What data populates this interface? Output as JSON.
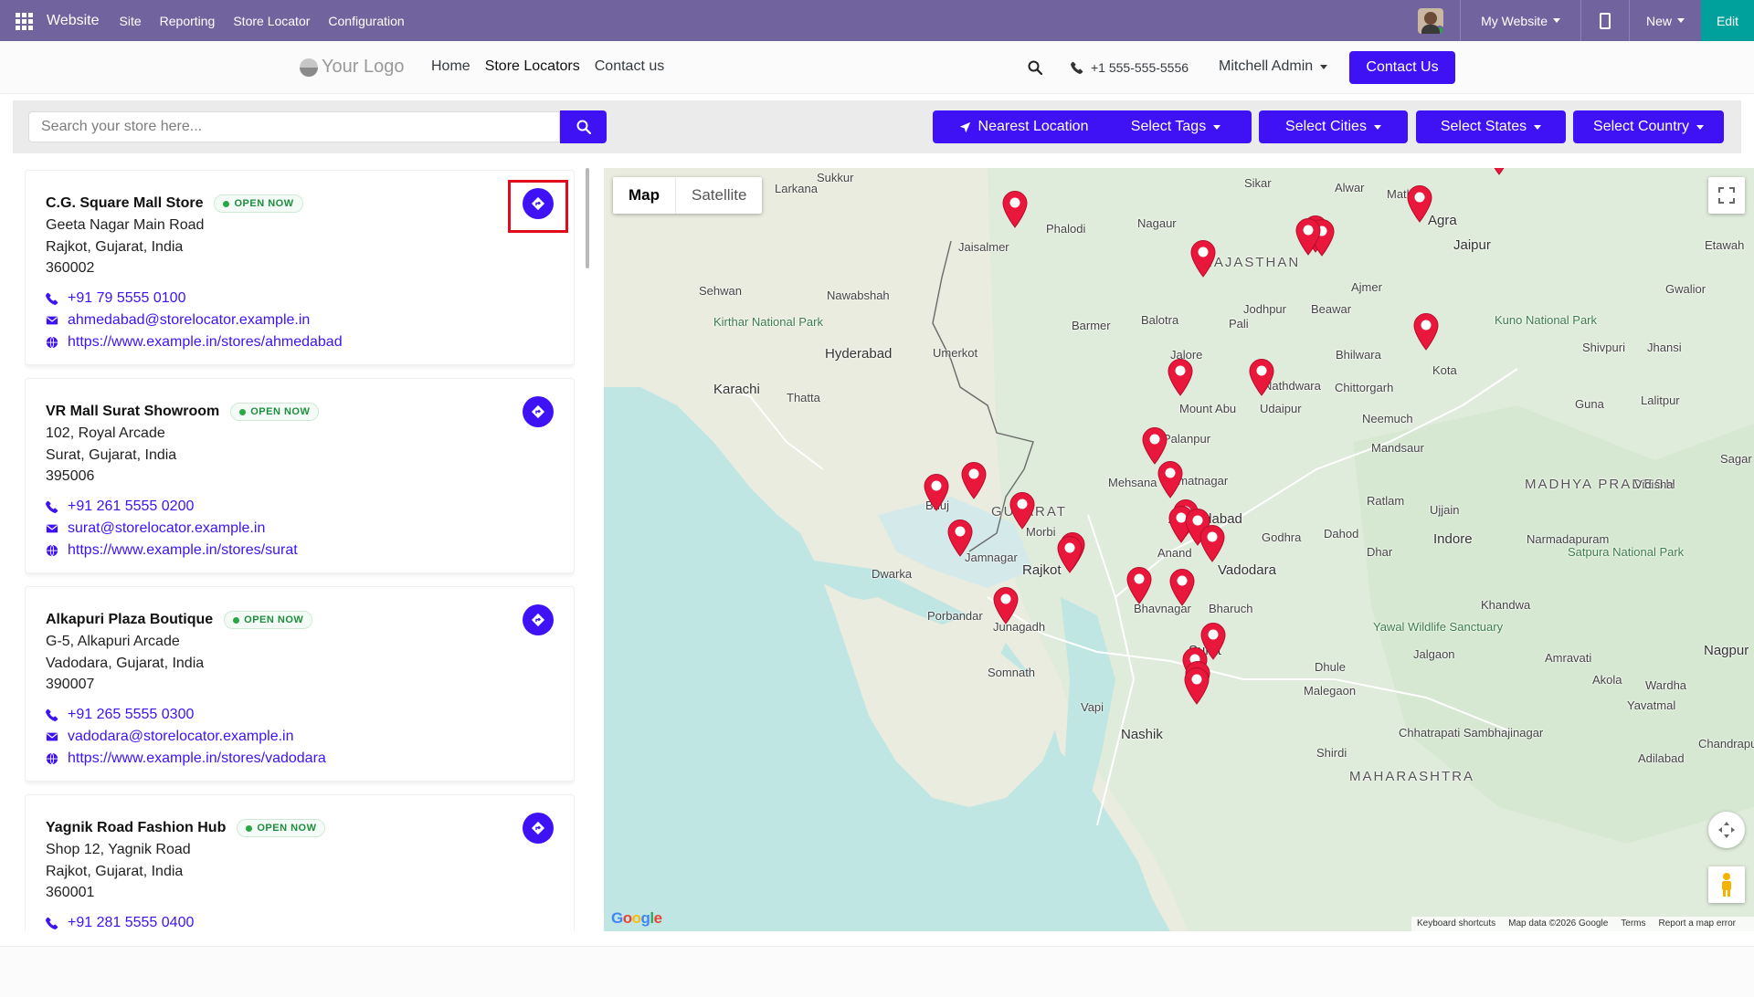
{
  "admin_bar": {
    "brand": "Website",
    "menu": [
      "Site",
      "Reporting",
      "Store Locator",
      "Configuration"
    ],
    "my_website": "My Website",
    "new_label": "New",
    "edit_label": "Edit"
  },
  "header": {
    "logo_text": "Your Logo",
    "nav": [
      "Home",
      "Store Locators",
      "Contact us"
    ],
    "phone": "+1 555-555-5556",
    "user": "Mitchell Admin",
    "contact_button": "Contact Us"
  },
  "filters": {
    "search_placeholder": "Search your store here...",
    "nearest": "Nearest Location",
    "tags": "Select Tags",
    "cities": "Select Cities",
    "states": "Select States",
    "country": "Select Country"
  },
  "stores": [
    {
      "name": "C.G. Square Mall Store",
      "status": "OPEN NOW",
      "address": [
        "Geeta Nagar Main Road",
        "Rajkot, Gujarat, India",
        "360002"
      ],
      "phone": "+91 79 5555 0100",
      "email": "ahmedabad@storelocator.example.in",
      "url": "https://www.example.in/stores/ahmedabad"
    },
    {
      "name": "VR Mall Surat Showroom",
      "status": "OPEN NOW",
      "address": [
        "102, Royal Arcade",
        "Surat, Gujarat, India",
        "395006"
      ],
      "phone": "+91 261 5555 0200",
      "email": "surat@storelocator.example.in",
      "url": "https://www.example.in/stores/surat"
    },
    {
      "name": "Alkapuri Plaza Boutique",
      "status": "OPEN NOW",
      "address": [
        "G-5, Alkapuri Arcade",
        "Vadodara, Gujarat, India",
        "390007"
      ],
      "phone": "+91 265 5555 0300",
      "email": "vadodara@storelocator.example.in",
      "url": "https://www.example.in/stores/vadodara"
    },
    {
      "name": "Yagnik Road Fashion Hub",
      "status": "OPEN NOW",
      "address": [
        "Shop 12, Yagnik Road",
        "Rajkot, Gujarat, India",
        "360001"
      ],
      "phone": "+91 281 5555 0400",
      "email": "",
      "url": ""
    }
  ],
  "map": {
    "type_map": "Map",
    "type_satellite": "Satellite",
    "attribution": [
      "Keyboard shortcuts",
      "Map data ©2026 Google",
      "Terms",
      "Report a map error"
    ],
    "google_letters": [
      "G",
      "o",
      "o",
      "g",
      "l",
      "e"
    ],
    "places": [
      "Sukkur",
      "Larkana",
      "Jaisalmer",
      "Phalodi",
      "Nagaur",
      "Sikar",
      "Jaipur",
      "Alwar",
      "Mathura",
      "Agra",
      "RAJASTHAN",
      "Ajmer",
      "Jodhpur",
      "Beawar",
      "Sehwan",
      "Nawabshah",
      "Kirthar National Park",
      "Hyderabad",
      "Umerkot",
      "Barmer",
      "Balotra",
      "Pali",
      "Bhilwara",
      "Kota",
      "Kuno National Park",
      "Shivpuri",
      "Jhansi",
      "Gwalior",
      "Etawah",
      "Karachi",
      "Thatta",
      "Jalore",
      "Nathdwara",
      "Chittorgarh",
      "Mount Abu",
      "Udaipur",
      "Neemuch",
      "Guna",
      "Lalitpur",
      "Palanpur",
      "Mandsaur",
      "Mehsana",
      "Himatnagar",
      "Ratlam",
      "Ujjain",
      "MADHYA PRADESH",
      "Vidisha",
      "Sagar",
      "Bhuj",
      "GUJARAT",
      "Ahmedabad",
      "Morbi",
      "Godhra",
      "Dahod",
      "Indore",
      "Narmadapuram",
      "Jamnagar",
      "Rajkot",
      "Anand",
      "Vadodara",
      "Dhar",
      "Satpura National Park",
      "Dwarka",
      "Bhavnagar",
      "Bharuch",
      "Khandwa",
      "Porbandar",
      "Junagadh",
      "Yawal Wildlife Sanctuary",
      "Surat",
      "Jalgaon",
      "Amravati",
      "Nagpur",
      "Somnath",
      "Dhule",
      "Akola",
      "Wardha",
      "Malegaon",
      "Vapi",
      "Yavatmal",
      "Nashik",
      "Chhatrapati Sambhajinagar",
      "Shirdi",
      "MAHARASHTRA",
      "Adilabad",
      "Chandrapur"
    ]
  },
  "colors": {
    "admin_bar": "#71639e",
    "primary": "#3e12f4",
    "edit": "#00a09d",
    "open_badge": "#1e8e3e",
    "marker": "#e8173b",
    "highlight": "#e00b1c"
  },
  "icons": [
    "apps-grid-icon",
    "mobile-preview-icon",
    "search-icon",
    "phone-icon",
    "envelope-icon",
    "globe-icon",
    "directions-icon",
    "location-arrow-icon",
    "fullscreen-icon",
    "compass-icon",
    "pegman-icon",
    "map-marker-icon"
  ]
}
